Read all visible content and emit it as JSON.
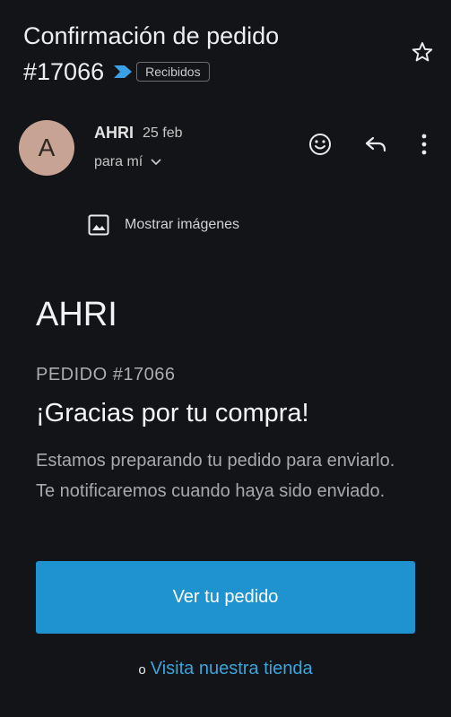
{
  "email": {
    "subject_line1": "Confirmación de pedido",
    "subject_line2": "#17066",
    "label": "Recibidos",
    "sender": "AHRI",
    "sender_initial": "A",
    "date": "25 feb",
    "recipient": "para mí",
    "show_images": "Mostrar imágenes"
  },
  "content": {
    "brand": "AHRI",
    "order_number": "PEDIDO #17066",
    "thanks": "¡Gracias por tu compra!",
    "message": "Estamos preparando tu pedido para enviarlo. Te notificaremos cuando haya sido enviado.",
    "cta_label": "Ver tu pedido",
    "or_text": "o",
    "store_link": "Visita nuestra tienda"
  },
  "icons": {
    "importance": "importance-marker-icon",
    "star": "star-icon",
    "emoji": "emoji-icon",
    "reply": "reply-icon",
    "more": "more-vert-icon",
    "chevron": "chevron-down-icon",
    "image": "image-icon"
  },
  "colors": {
    "background": "#131418",
    "accent": "#1e93cf",
    "link": "#3aa4dc",
    "importance": "#3ba1e6",
    "avatar": "#c7a394"
  }
}
